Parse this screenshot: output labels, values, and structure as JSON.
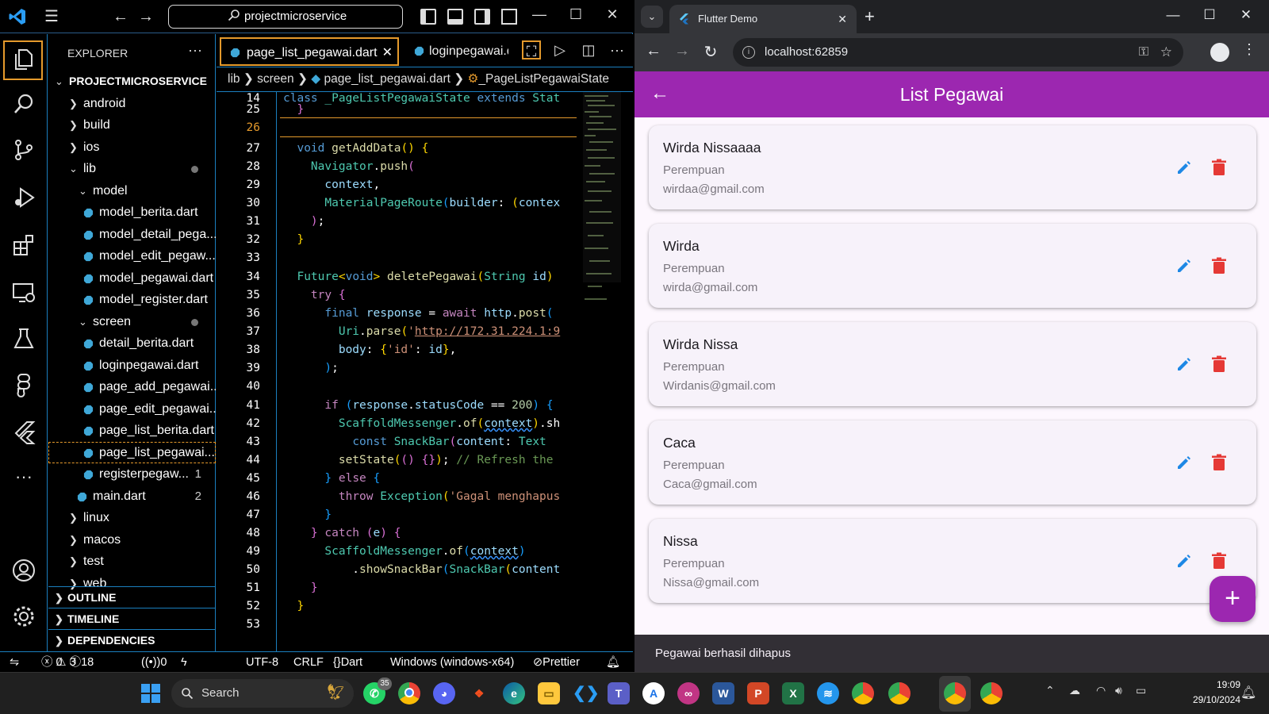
{
  "vscode": {
    "search_text": "projectmicroservice",
    "explorer_title": "EXPLORER",
    "tree": [
      {
        "label": "PROJECTMICROSERVICE",
        "depth": 0,
        "type": "folder-open",
        "bold": true
      },
      {
        "label": "android",
        "depth": 1,
        "type": "folder"
      },
      {
        "label": "build",
        "depth": 1,
        "type": "folder"
      },
      {
        "label": "ios",
        "depth": 1,
        "type": "folder"
      },
      {
        "label": "lib",
        "depth": 1,
        "type": "folder-open",
        "dot": true
      },
      {
        "label": "model",
        "depth": 2,
        "type": "folder-open"
      },
      {
        "label": "model_berita.dart",
        "depth": 3,
        "type": "file"
      },
      {
        "label": "model_detail_pega...",
        "depth": 3,
        "type": "file"
      },
      {
        "label": "model_edit_pegaw...",
        "depth": 3,
        "type": "file"
      },
      {
        "label": "model_pegawai.dart",
        "depth": 3,
        "type": "file"
      },
      {
        "label": "model_register.dart",
        "depth": 3,
        "type": "file"
      },
      {
        "label": "screen",
        "depth": 2,
        "type": "folder-open",
        "dot": true
      },
      {
        "label": "detail_berita.dart",
        "depth": 3,
        "type": "file"
      },
      {
        "label": "loginpegawai.dart",
        "depth": 3,
        "type": "file"
      },
      {
        "label": "page_add_pegawai...",
        "depth": 3,
        "type": "file"
      },
      {
        "label": "page_edit_pegawai...",
        "depth": 3,
        "type": "file"
      },
      {
        "label": "page_list_berita.dart",
        "depth": 3,
        "type": "file"
      },
      {
        "label": "page_list_pegawai....",
        "depth": 3,
        "type": "file",
        "selected": true
      },
      {
        "label": "registerpegaw...",
        "depth": 3,
        "type": "file",
        "badge": "1"
      },
      {
        "label": "main.dart",
        "depth": 2,
        "type": "file",
        "badge": "2"
      },
      {
        "label": "linux",
        "depth": 1,
        "type": "folder"
      },
      {
        "label": "macos",
        "depth": 1,
        "type": "folder"
      },
      {
        "label": "test",
        "depth": 1,
        "type": "folder"
      },
      {
        "label": "web",
        "depth": 1,
        "type": "folder"
      }
    ],
    "sections": [
      "OUTLINE",
      "TIMELINE",
      "DEPENDENCIES"
    ],
    "tabs": [
      {
        "label": "page_list_pegawai.dart",
        "active": true
      },
      {
        "label": "loginpegawai.d",
        "active": false
      }
    ],
    "breadcrumb": {
      "p1": "lib",
      "p2": "screen",
      "p3": "page_list_pegawai.dart",
      "p4": "_PageListPegawaiState"
    },
    "line_numbers": [
      "14",
      "25",
      "26",
      "27",
      "28",
      "29",
      "30",
      "31",
      "32",
      "33",
      "34",
      "35",
      "36",
      "37",
      "38",
      "39",
      "40",
      "41",
      "42",
      "43",
      "44",
      "45",
      "46",
      "47",
      "48",
      "49",
      "50",
      "51",
      "52",
      "53"
    ],
    "status": {
      "errors": "0",
      "warnings": "3",
      "infos": "18",
      "ports": "0",
      "encoding": "UTF-8",
      "eol": "CRLF",
      "language": "Dart",
      "platform": "Windows (windows-x64)",
      "formatter": "Prettier"
    }
  },
  "browser": {
    "tab_title": "Flutter Demo",
    "url": "localhost:62859",
    "app": {
      "title": "List Pegawai",
      "employees": [
        {
          "name": "Wirda Nissaaaa",
          "gender": "Perempuan",
          "email": "wirdaa@gmail.com"
        },
        {
          "name": "Wirda",
          "gender": "Perempuan",
          "email": "wirda@gmail.com"
        },
        {
          "name": "Wirda Nissa",
          "gender": "Perempuan",
          "email": "Wirdanis@gmail.com"
        },
        {
          "name": "Caca",
          "gender": "Perempuan",
          "email": "Caca@gmail.com"
        },
        {
          "name": "Nissa",
          "gender": "Perempuan",
          "email": "Nissa@gmail.com"
        }
      ],
      "fab_label": "+",
      "snackbar": "Pegawai berhasil dihapus"
    }
  },
  "taskbar": {
    "search_label": "Search",
    "whatsapp_badge": "35",
    "time": "19:09",
    "date": "29/10/2024"
  },
  "colors": {
    "accent": "#9c27b0",
    "vscode_border": "#1b7fbf",
    "focus": "#e59a2c",
    "delete": "#e53935",
    "edit": "#1e88e5"
  }
}
